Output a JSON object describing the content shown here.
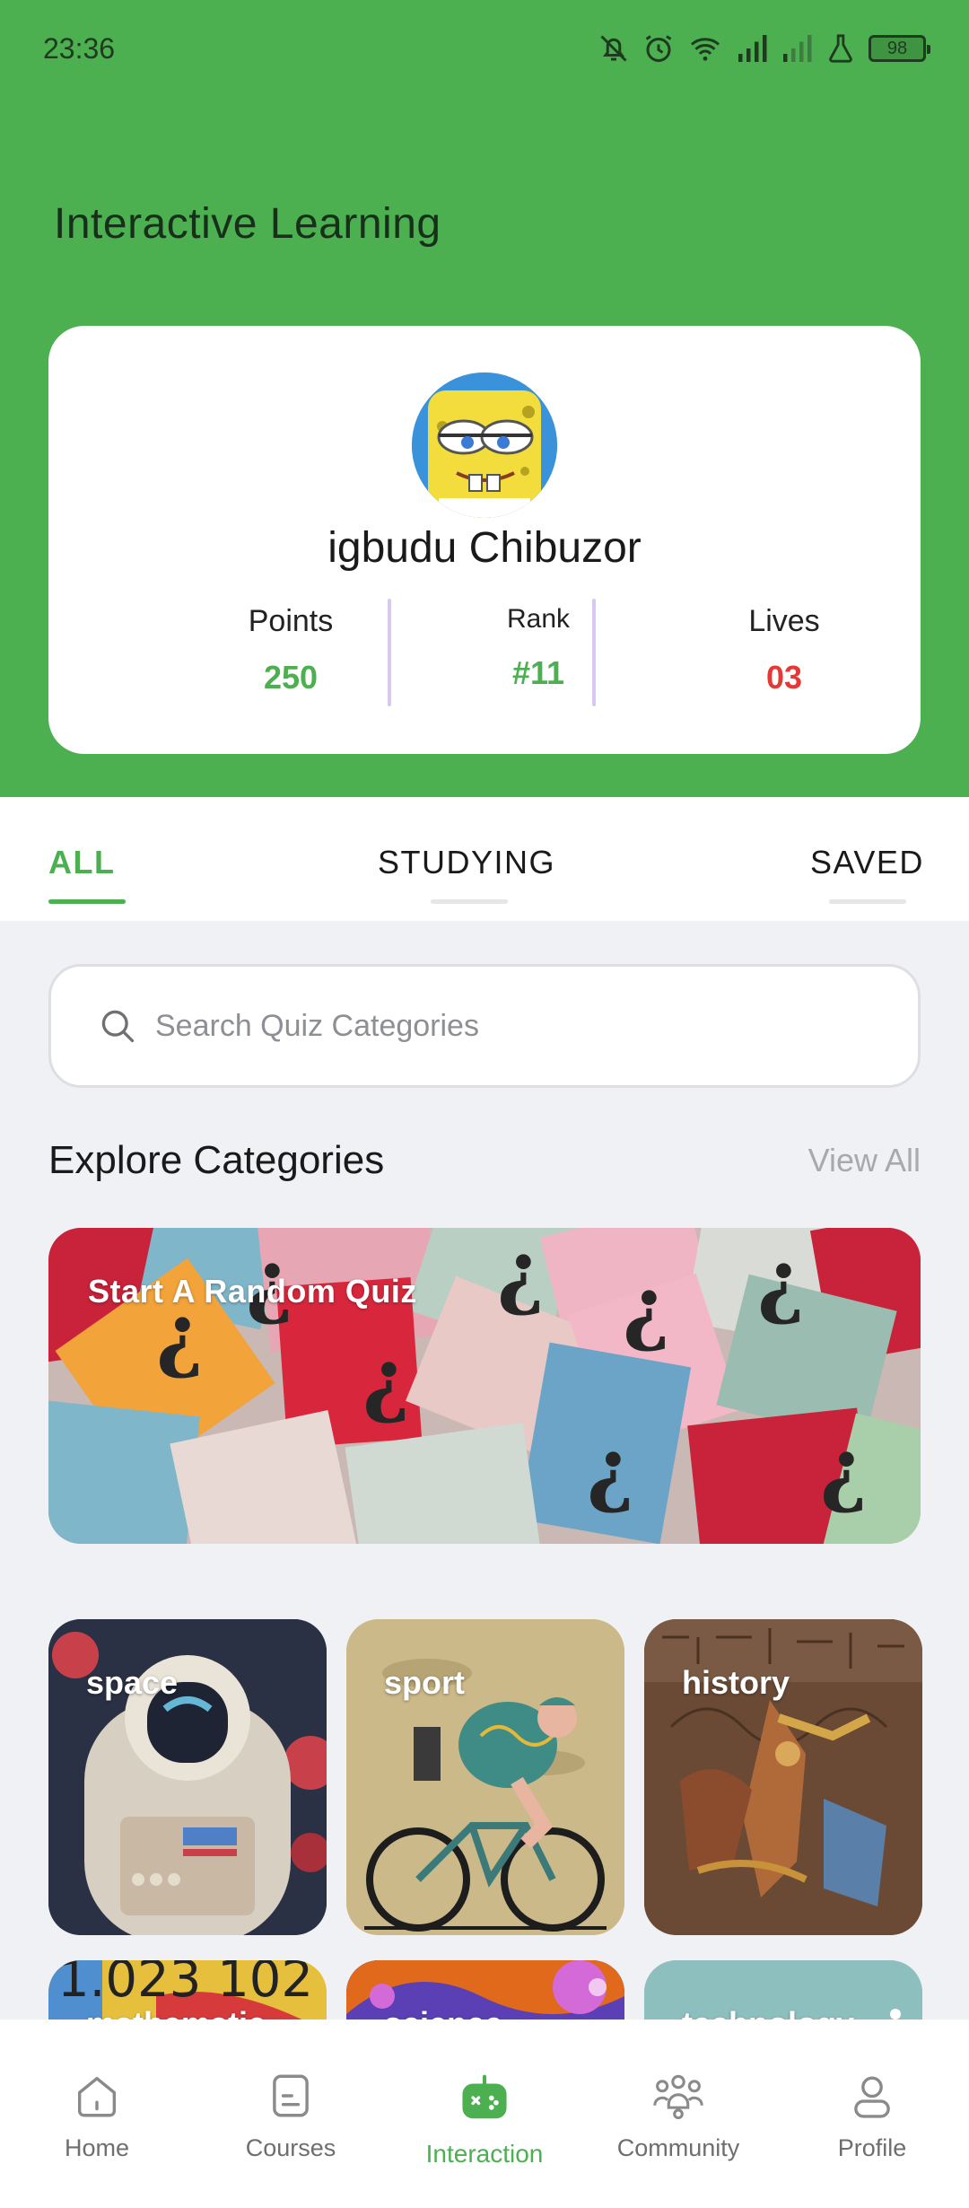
{
  "status_bar": {
    "time": "23:36",
    "battery": "98",
    "icons": [
      "mute-bell-icon",
      "alarm-icon",
      "wifi-icon",
      "signal-icon",
      "signal-weak-icon",
      "lab-flask-icon",
      "battery-icon"
    ]
  },
  "header": {
    "title": "Interactive Learning"
  },
  "profile": {
    "name": "igbudu Chibuzor",
    "stats": {
      "points_label": "Points",
      "points_value": "250",
      "rank_label": "Rank",
      "rank_value": "#11",
      "lives_label": "Lives",
      "lives_value": "03"
    }
  },
  "tabs": {
    "all": "ALL",
    "studying": "STUDYING",
    "saved": "SAVED",
    "active": "ALL"
  },
  "search": {
    "placeholder": "Search Quiz Categories"
  },
  "categories": {
    "title": "Explore Categories",
    "view_all": "View All",
    "random_quiz": "Start A Random Quiz",
    "items": [
      "space",
      "sport",
      "history",
      "mathematic",
      "science",
      "technology"
    ]
  },
  "bottom_nav": {
    "home": "Home",
    "courses": "Courses",
    "interaction": "Interaction",
    "community": "Community",
    "profile": "Profile",
    "active": "Interaction"
  },
  "colors": {
    "primary": "#4caf50",
    "lives": "#e53935",
    "divider": "#d9c8f0"
  }
}
